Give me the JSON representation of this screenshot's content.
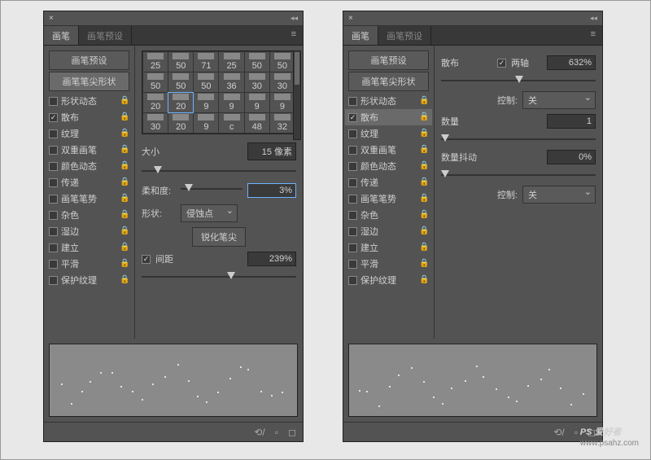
{
  "titlebar": {
    "close": "×",
    "collapse": "◂◂"
  },
  "tabs": {
    "brush": "画笔",
    "preset": "画笔预设",
    "menu": "≡"
  },
  "sidebar": {
    "presets_btn": "画笔预设",
    "tip_shape_btn": "画笔笔尖形状",
    "items": [
      {
        "label": "形状动态",
        "checked": false,
        "lock": true
      },
      {
        "label": "散布",
        "checked": true,
        "lock": true
      },
      {
        "label": "纹理",
        "checked": false,
        "lock": true
      },
      {
        "label": "双重画笔",
        "checked": false,
        "lock": true
      },
      {
        "label": "颜色动态",
        "checked": false,
        "lock": true
      },
      {
        "label": "传递",
        "checked": false,
        "lock": true
      },
      {
        "label": "画笔笔势",
        "checked": false,
        "lock": true
      },
      {
        "label": "杂色",
        "checked": false,
        "lock": true
      },
      {
        "label": "湿边",
        "checked": false,
        "lock": true
      },
      {
        "label": "建立",
        "checked": false,
        "lock": true
      },
      {
        "label": "平滑",
        "checked": false,
        "lock": true
      },
      {
        "label": "保护纹理",
        "checked": false,
        "lock": true
      }
    ]
  },
  "left": {
    "thumbs": [
      [
        "25",
        "50",
        "71",
        "25",
        "50",
        "50"
      ],
      [
        "50",
        "50",
        "50",
        "36",
        "30",
        "30"
      ],
      [
        "20",
        "20",
        "9",
        "9",
        "9",
        "9"
      ],
      [
        "30",
        "20",
        "9",
        "c",
        "48",
        "32"
      ]
    ],
    "size": {
      "label": "大小",
      "value": "15 像素",
      "pos": 8
    },
    "softness": {
      "label": "柔和度:",
      "value": "3%",
      "pos": 6
    },
    "shape": {
      "label": "形状:",
      "value": "侵蚀点"
    },
    "sharpen_btn": "锐化笔尖",
    "spacing": {
      "label": "间距",
      "checked": true,
      "value": "239%",
      "pos": 55
    }
  },
  "right": {
    "scatter": {
      "label": "散布",
      "both_axes_label": "两轴",
      "both_axes_checked": true,
      "value": "632%",
      "pos": 48
    },
    "control1": {
      "label": "控制:",
      "value": "关"
    },
    "count": {
      "label": "数量",
      "value": "1",
      "pos": 0
    },
    "jitter": {
      "label": "数量抖动",
      "value": "0%",
      "pos": 0
    },
    "control2": {
      "label": "控制:",
      "value": "关"
    }
  },
  "footer": {
    "i1": "⟲/",
    "i2": "▫",
    "i3": "◻"
  },
  "watermark": {
    "logo": "PS 爱好者",
    "url": "www.psahz.com"
  }
}
